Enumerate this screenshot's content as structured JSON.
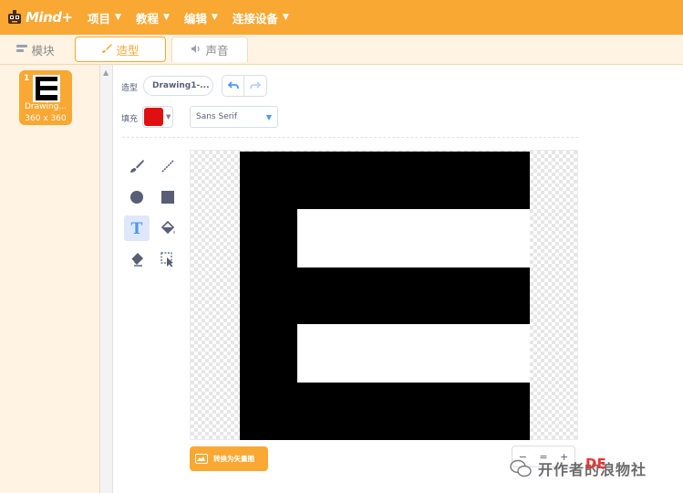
{
  "app": {
    "logo_text": "Mind+"
  },
  "menu": [
    {
      "label": "项目"
    },
    {
      "label": "教程"
    },
    {
      "label": "编辑"
    },
    {
      "label": "连接设备"
    }
  ],
  "tabs": {
    "blocks": "模块",
    "costumes": "造型",
    "sounds": "声音"
  },
  "costume_list": [
    {
      "number": "1",
      "name": "Drawing...",
      "size": "360 x 360"
    }
  ],
  "editor": {
    "costume_label": "造型",
    "costume_name": "Drawing1-...",
    "fill_label": "填充",
    "fill_color": "#e01010",
    "font": "Sans Serif",
    "selected_tool": "text-tool",
    "convert_button": "转换为矢量图",
    "zoom": {
      "out": "−",
      "reset": "=",
      "in": "+"
    }
  },
  "colors": {
    "brand": "#f9a833",
    "tab_active": "#f9a833",
    "tool_active_bg": "#dfe8fa"
  },
  "watermark": {
    "text": "开作者的浪物社",
    "de": "DE"
  }
}
